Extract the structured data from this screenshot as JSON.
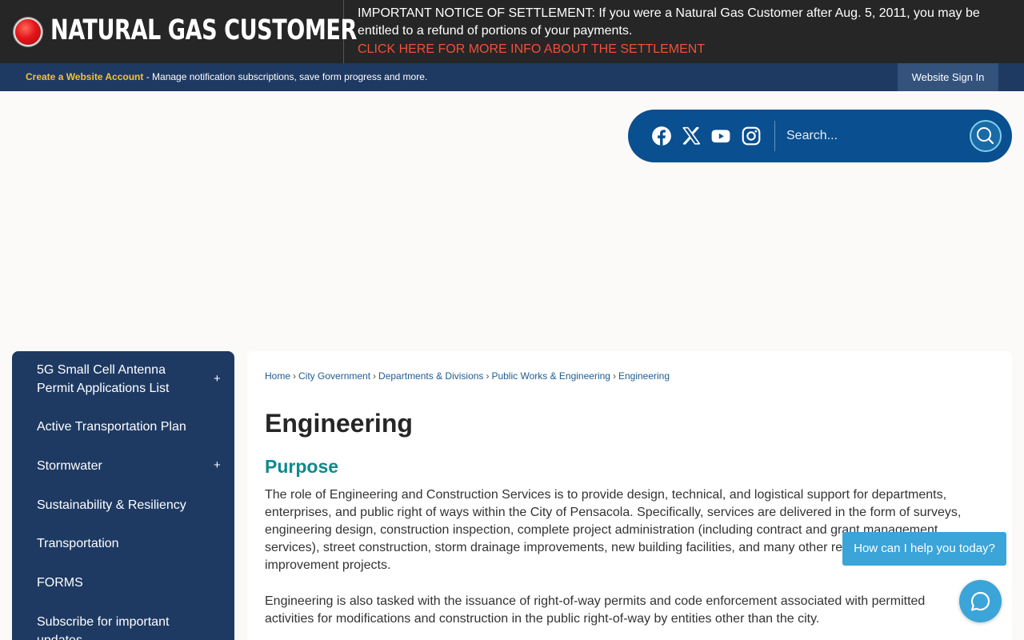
{
  "alert": {
    "title": "NATURAL GAS CUSTOMER",
    "notice": "IMPORTANT NOTICE OF SETTLEMENT: If you were a Natural Gas Customer after Aug. 5, 2011, you may be entitled to a refund of portions of your payments.",
    "link": "CLICK HERE FOR MORE INFO ABOUT THE SETTLEMENT"
  },
  "account_bar": {
    "create_label": "Create a Website Account",
    "description": " - Manage notification subscriptions, save form progress and more.",
    "signin_label": "Website Sign In"
  },
  "social": [
    "facebook-icon",
    "x-twitter-icon",
    "youtube-icon",
    "instagram-icon"
  ],
  "search": {
    "placeholder": "Search..."
  },
  "sidenav": {
    "items": [
      {
        "label": "5G Small Cell Antenna Permit Applications List",
        "expandable": "+"
      },
      {
        "label": "Active Transportation Plan",
        "expandable": ""
      },
      {
        "label": "Stormwater",
        "expandable": "+"
      },
      {
        "label": "Sustainability & Resiliency",
        "expandable": ""
      },
      {
        "label": "Transportation",
        "expandable": ""
      },
      {
        "label": "FORMS",
        "expandable": ""
      },
      {
        "label": "Subscribe for important updates",
        "expandable": ""
      }
    ]
  },
  "breadcrumbs": [
    "Home",
    "City Government",
    "Departments & Divisions",
    "Public Works & Engineering",
    "Engineering"
  ],
  "crumb_separator": "›",
  "content": {
    "title": "Engineering",
    "heading": "Purpose",
    "para1": "The role of Engineering and Construction Services is to provide design, technical, and logistical support for departments, enterprises, and public right of ways within the City of Pensacola. Specifically, services are delivered in the form of surveys, engineering design, construction inspection, complete project administration (including contract and grant management services), street construction, storm drainage improvements, new building facilities, and many other related capital improvement projects.",
    "para2": "Engineering is also tasked with the issuance of right-of-way permits and code enforcement associated with permitted activities for modifications and construction in the public right-of-way by entities other than the city."
  },
  "chat": {
    "prompt": "How can I help you today?"
  }
}
